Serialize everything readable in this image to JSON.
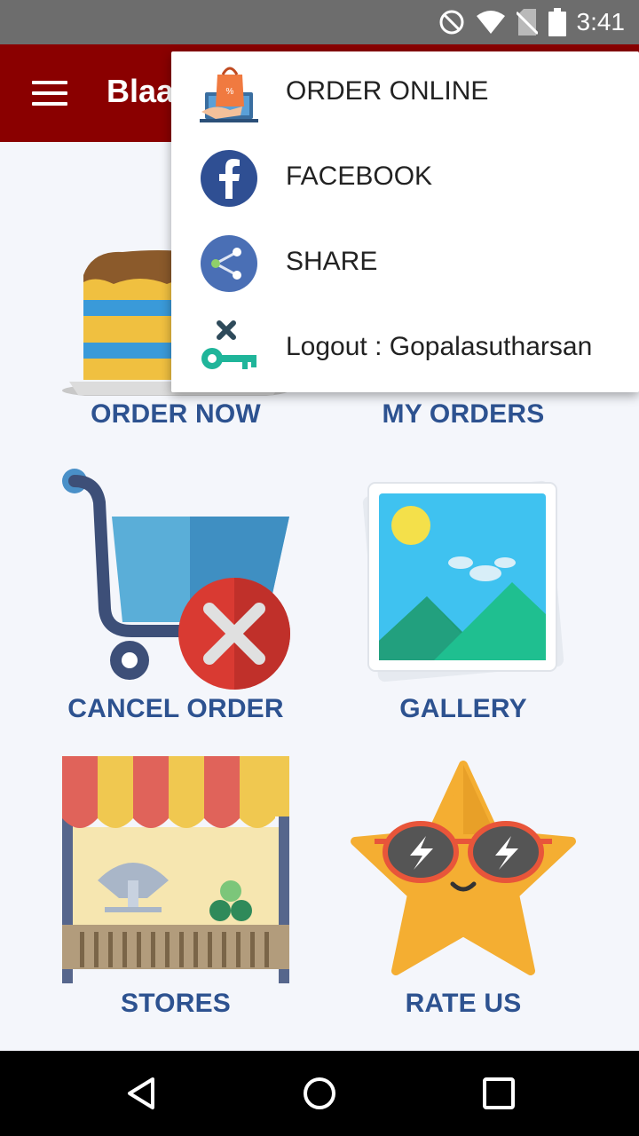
{
  "status_bar": {
    "time": "3:41",
    "icons": [
      "do-not-disturb-icon",
      "wifi-icon",
      "no-sim-icon",
      "battery-icon"
    ]
  },
  "app_bar": {
    "title": "Blaa",
    "menu_icon": "hamburger-menu-icon",
    "color": "#8a0000"
  },
  "grid": {
    "label_color": "#2d5290",
    "tiles": [
      {
        "label": "ORDER NOW",
        "icon": "cake-icon"
      },
      {
        "label": "MY ORDERS",
        "icon": "orders-icon"
      },
      {
        "label": "CANCEL ORDER",
        "icon": "cart-cancel-icon"
      },
      {
        "label": "GALLERY",
        "icon": "gallery-icon"
      },
      {
        "label": "STORES",
        "icon": "store-icon"
      },
      {
        "label": "RATE US",
        "icon": "star-sunglasses-icon"
      }
    ]
  },
  "menu": {
    "items": [
      {
        "label": "ORDER ONLINE",
        "icon": "shopping-bag-laptop-icon"
      },
      {
        "label": "FACEBOOK",
        "icon": "facebook-icon"
      },
      {
        "label": "SHARE",
        "icon": "share-icon"
      },
      {
        "label": "Logout : Gopalasutharsan",
        "icon": "logout-key-icon"
      }
    ]
  },
  "nav_bar": {
    "buttons": [
      "back-icon",
      "home-icon",
      "recents-icon"
    ]
  }
}
